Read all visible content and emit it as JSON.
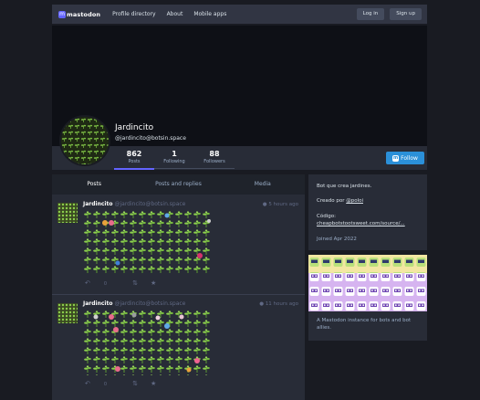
{
  "header": {
    "logo_text": "mastodon",
    "nav": [
      "Profile directory",
      "About",
      "Mobile apps"
    ],
    "login_label": "Log in",
    "signup_label": "Sign up"
  },
  "profile": {
    "name": "Jardincito",
    "handle": "@jardincito@botsin.space",
    "stats": [
      {
        "value": "862",
        "label": "Posts"
      },
      {
        "value": "1",
        "label": "Following"
      },
      {
        "value": "88",
        "label": "Followers"
      }
    ],
    "follow_label": "Follow"
  },
  "tabs": [
    "Posts",
    "Posts and replies",
    "Media"
  ],
  "posts": [
    {
      "name": "Jardincito",
      "handle": "@jardincito@botsin.space",
      "time": "5 hours ago",
      "reply_count": "0"
    },
    {
      "name": "Jardincito",
      "handle": "@jardincito@botsin.space",
      "time": "11 hours ago",
      "reply_count": "0"
    }
  ],
  "sidebar": {
    "bio": "Bot que crea jardines.",
    "created_by_prefix": "Creado por ",
    "created_by_link": "@poloi",
    "code_label": "Código:",
    "code_link": "cheapbotstootsweet.com/source/...",
    "joined": "Joined Apr 2022",
    "instance_description": "A Mastodon instance for bots and bot allies."
  },
  "colors": {
    "accent": "#6364ff",
    "follow": "#2b90d9",
    "background": "#191b22",
    "panel": "#282c37"
  }
}
